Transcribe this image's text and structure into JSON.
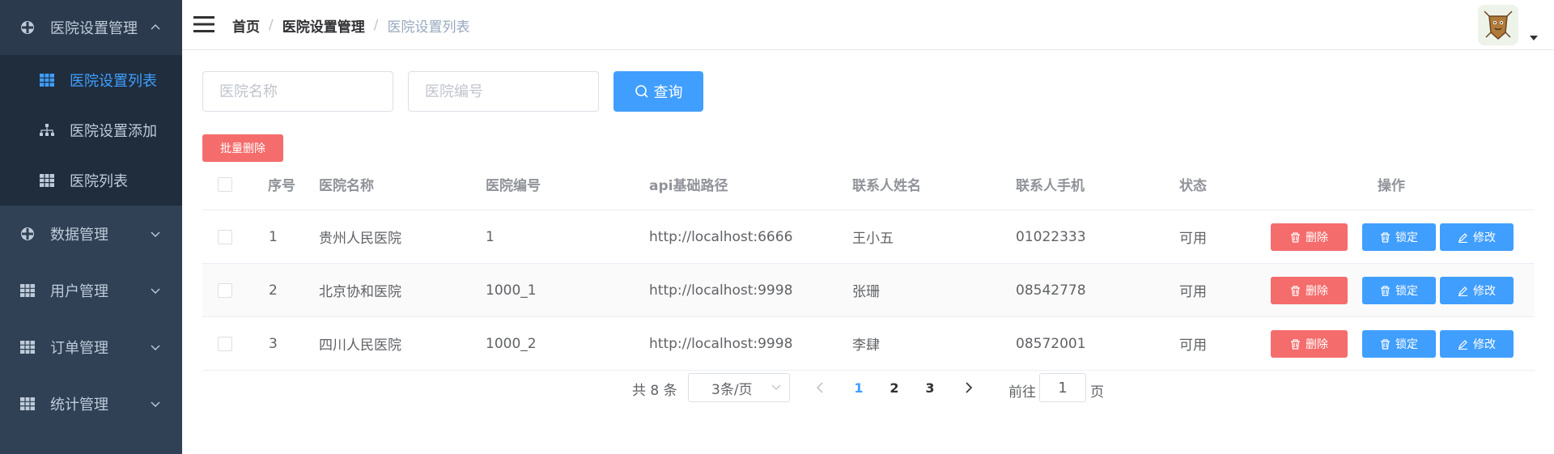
{
  "sidebar": {
    "groups": [
      {
        "label": "医院设置管理",
        "open": true
      },
      {
        "label": "数据管理"
      },
      {
        "label": "用户管理"
      },
      {
        "label": "订单管理"
      },
      {
        "label": "统计管理"
      }
    ],
    "sub_items": [
      {
        "label": "医院设置列表",
        "active": true
      },
      {
        "label": "医院设置添加"
      },
      {
        "label": "医院列表"
      }
    ],
    "colors": {
      "bg": "#304156",
      "sub_bg": "#1f2d3d",
      "text": "#bfcbd9",
      "active": "#409eff"
    }
  },
  "header": {
    "breadcrumb": [
      "首页",
      "医院设置管理",
      "医院设置列表"
    ],
    "separator": "/"
  },
  "search": {
    "name_placeholder": "医院名称",
    "code_placeholder": "医院编号",
    "query_label": "查询"
  },
  "batch_delete_label": "批量删除",
  "table": {
    "columns": [
      "序号",
      "医院名称",
      "医院编号",
      "api基础路径",
      "联系人姓名",
      "联系人手机",
      "状态",
      "操作"
    ],
    "rows": [
      {
        "index": "1",
        "name": "贵州人民医院",
        "code": "1",
        "api": "http://localhost:6666",
        "contact": "王小五",
        "phone": "01022333",
        "status": "可用"
      },
      {
        "index": "2",
        "name": "北京协和医院",
        "code": "1000_1",
        "api": "http://localhost:9998",
        "contact": "张珊",
        "phone": "08542778",
        "status": "可用"
      },
      {
        "index": "3",
        "name": "四川人民医院",
        "code": "1000_2",
        "api": "http://localhost:9998",
        "contact": "李肆",
        "phone": "08572001",
        "status": "可用"
      }
    ],
    "actions": {
      "delete": "删除",
      "lock": "锁定",
      "edit": "修改"
    }
  },
  "pagination": {
    "total_text": "共 8 条",
    "page_size": "3条/页",
    "pages": [
      "1",
      "2",
      "3"
    ],
    "current": "1",
    "goto_prefix": "前往",
    "goto_value": "1",
    "goto_suffix": "页"
  },
  "colors": {
    "primary": "#409eff",
    "danger": "#f56c6c"
  }
}
